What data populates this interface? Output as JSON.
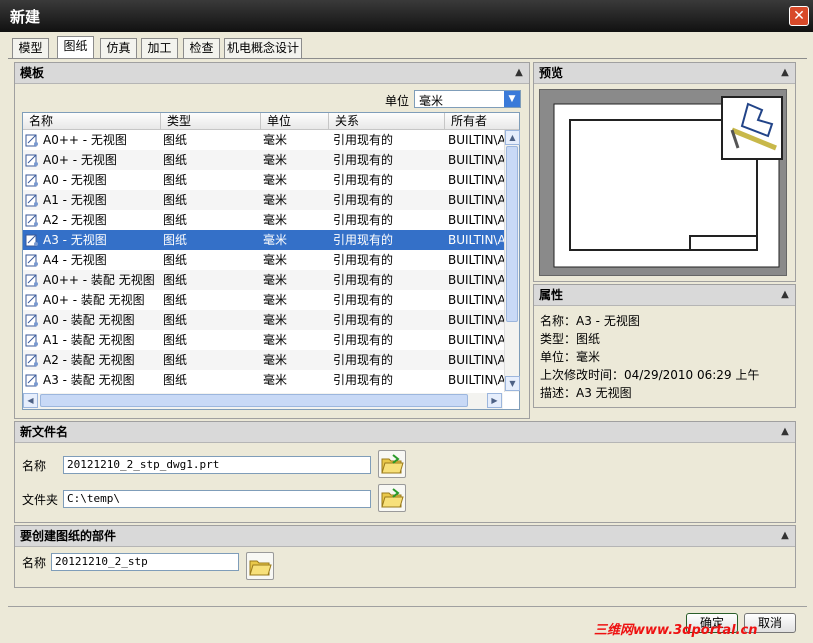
{
  "window": {
    "title": "新建",
    "close_label": "✕"
  },
  "tabs": [
    {
      "label": "模型"
    },
    {
      "label": "图纸"
    },
    {
      "label": "仿真"
    },
    {
      "label": "加工"
    },
    {
      "label": "检查"
    },
    {
      "label": "机电概念设计"
    }
  ],
  "active_tab": "图纸",
  "template_panel": {
    "title": "模板",
    "unit_label": "单位",
    "unit_value": "毫米",
    "columns": [
      "名称",
      "类型",
      "单位",
      "关系",
      "所有者"
    ],
    "rows": [
      {
        "name": "A0++ - 无视图",
        "type": "图纸",
        "unit": "毫米",
        "relation": "引用现有的",
        "owner": "BUILTIN\\A"
      },
      {
        "name": "A0+ - 无视图",
        "type": "图纸",
        "unit": "毫米",
        "relation": "引用现有的",
        "owner": "BUILTIN\\A"
      },
      {
        "name": "A0 - 无视图",
        "type": "图纸",
        "unit": "毫米",
        "relation": "引用现有的",
        "owner": "BUILTIN\\A"
      },
      {
        "name": "A1 - 无视图",
        "type": "图纸",
        "unit": "毫米",
        "relation": "引用现有的",
        "owner": "BUILTIN\\A"
      },
      {
        "name": "A2 - 无视图",
        "type": "图纸",
        "unit": "毫米",
        "relation": "引用现有的",
        "owner": "BUILTIN\\A"
      },
      {
        "name": "A3 - 无视图",
        "type": "图纸",
        "unit": "毫米",
        "relation": "引用现有的",
        "owner": "BUILTIN\\A"
      },
      {
        "name": "A4 - 无视图",
        "type": "图纸",
        "unit": "毫米",
        "relation": "引用现有的",
        "owner": "BUILTIN\\A"
      },
      {
        "name": "A0++ - 装配 无视图",
        "type": "图纸",
        "unit": "毫米",
        "relation": "引用现有的",
        "owner": "BUILTIN\\A"
      },
      {
        "name": "A0+ - 装配 无视图",
        "type": "图纸",
        "unit": "毫米",
        "relation": "引用现有的",
        "owner": "BUILTIN\\A"
      },
      {
        "name": "A0 - 装配 无视图",
        "type": "图纸",
        "unit": "毫米",
        "relation": "引用现有的",
        "owner": "BUILTIN\\A"
      },
      {
        "name": "A1 - 装配 无视图",
        "type": "图纸",
        "unit": "毫米",
        "relation": "引用现有的",
        "owner": "BUILTIN\\A"
      },
      {
        "name": "A2 - 装配 无视图",
        "type": "图纸",
        "unit": "毫米",
        "relation": "引用现有的",
        "owner": "BUILTIN\\A"
      },
      {
        "name": "A3 - 装配 无视图",
        "type": "图纸",
        "unit": "毫米",
        "relation": "引用现有的",
        "owner": "BUILTIN\\A"
      }
    ],
    "selected_index": 5
  },
  "preview_panel": {
    "title": "预览"
  },
  "properties_panel": {
    "title": "属性",
    "items": [
      {
        "label": "名称：",
        "value": "A3 - 无视图"
      },
      {
        "label": "类型：",
        "value": "图纸"
      },
      {
        "label": "单位：",
        "value": "毫米"
      },
      {
        "label": "上次修改时间：",
        "value": "04/29/2010 06:29 上午"
      },
      {
        "label": "描述：",
        "value": "A3 无视图"
      }
    ]
  },
  "new_file_panel": {
    "title": "新文件名",
    "name_label": "名称",
    "name_value": "20121210_2_stp_dwg1.prt",
    "folder_label": "文件夹",
    "folder_value": "C:\\temp\\"
  },
  "part_panel": {
    "title": "要创建图纸的部件",
    "name_label": "名称",
    "name_value": "20121210_2_stp"
  },
  "buttons": {
    "ok": "确定",
    "cancel": "取消"
  },
  "watermark": "三维网www.3dportal.cn",
  "colors": {
    "selection": "#3470c8",
    "titlebar": "#1e1e1e",
    "panel_bg": "#ece9d8"
  }
}
